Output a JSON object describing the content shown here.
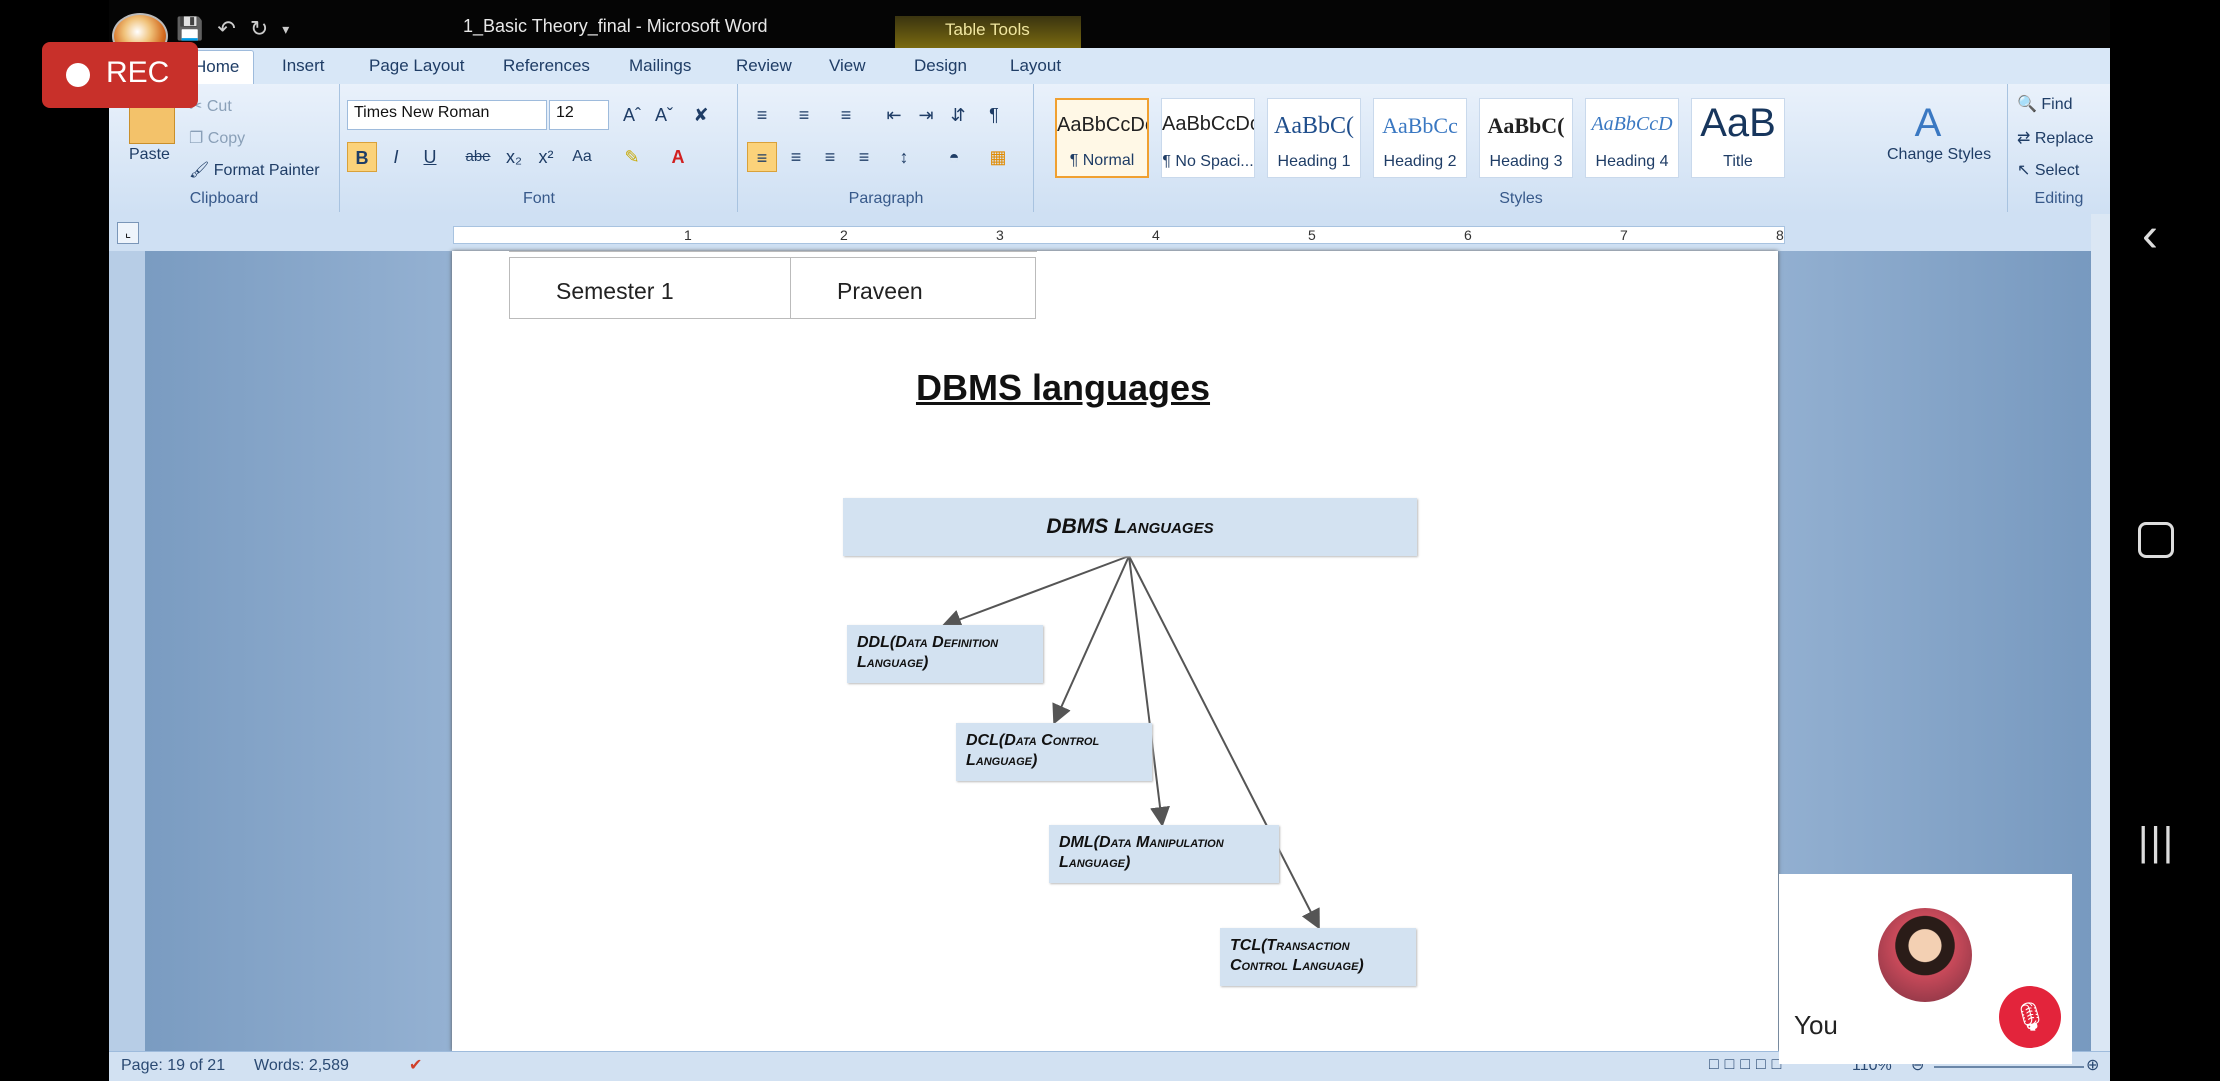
{
  "titlebar": {
    "doc_title": "1_Basic Theory_final - Microsoft Word",
    "table_tools": "Table Tools"
  },
  "tabs": [
    "Home",
    "Insert",
    "Page Layout",
    "References",
    "Mailings",
    "Review",
    "View",
    "Design",
    "Layout"
  ],
  "ribbon": {
    "clipboard": {
      "paste": "Paste",
      "cut": "Cut",
      "copy": "Copy",
      "format_painter": "Format Painter",
      "label": "Clipboard"
    },
    "font": {
      "font_name": "Times New Roman",
      "font_size": "12",
      "label": "Font",
      "bold": "B",
      "italic": "I",
      "underline": "U",
      "strike": "abe",
      "change_case": "Aa"
    },
    "paragraph": {
      "label": "Paragraph"
    },
    "styles": {
      "label": "Styles",
      "items": [
        {
          "preview": "AaBbCcDc",
          "name": "¶ Normal"
        },
        {
          "preview": "AaBbCcDc",
          "name": "¶ No Spaci..."
        },
        {
          "preview": "AaBbC(",
          "name": "Heading 1"
        },
        {
          "preview": "AaBbCc",
          "name": "Heading 2"
        },
        {
          "preview": "AaBbC(",
          "name": "Heading 3"
        },
        {
          "preview": "AaBbCcD",
          "name": "Heading 4"
        },
        {
          "preview": "AaB",
          "name": "Title"
        }
      ],
      "change_styles": "Change Styles"
    },
    "editing": {
      "find": "Find",
      "replace": "Replace",
      "select": "Select",
      "label": "Editing"
    }
  },
  "ruler": {
    "numbers": [
      "1",
      "2",
      "3",
      "4",
      "5",
      "6",
      "7",
      "8"
    ]
  },
  "document": {
    "table_row": {
      "col1": "Semester 1",
      "col2": "Praveen"
    },
    "heading": "DBMS languages",
    "diagram": {
      "root": "DBMS Languages",
      "children": [
        "DDL(Data Definition Language)",
        "DCL(Data Control Language)",
        "DML(Data Manipulation Language)",
        "TCL(Transaction Control Language)"
      ]
    }
  },
  "status": {
    "page": "Page: 19 of 21",
    "words": "Words: 2,589",
    "zoom": "110%"
  },
  "overlay": {
    "rec": "REC",
    "you": "You"
  }
}
